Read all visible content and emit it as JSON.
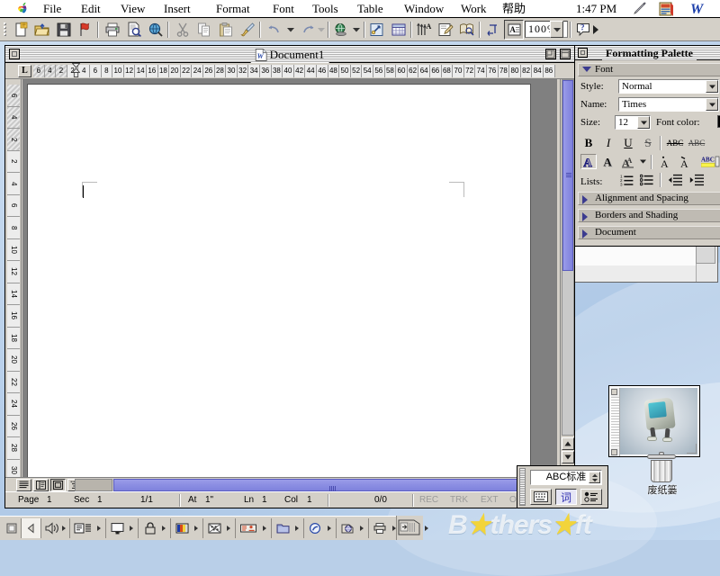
{
  "menubar": {
    "apple_icon": "apple-logo-icon",
    "items": [
      {
        "label": "File"
      },
      {
        "label": "Edit"
      },
      {
        "label": "View"
      },
      {
        "label": "Insert"
      },
      {
        "label": "Format"
      },
      {
        "label": "Font"
      },
      {
        "label": "Tools"
      },
      {
        "label": "Table"
      },
      {
        "label": "Window"
      },
      {
        "label": "Work"
      },
      {
        "label": "帮助"
      }
    ],
    "clock": "1:47 PM",
    "icons": [
      {
        "name": "pencil-icon"
      },
      {
        "name": "application-switcher-icon"
      },
      {
        "name": "word-app-icon",
        "label": "W"
      }
    ]
  },
  "toolbar": {
    "buttons": [
      {
        "name": "new-document-button",
        "tip": "New"
      },
      {
        "name": "open-file-button",
        "tip": "Open"
      },
      {
        "name": "save-button",
        "tip": "Save"
      },
      {
        "name": "flag-button",
        "tip": "Mail Recipient"
      },
      {
        "name": "print-button",
        "tip": "Print"
      },
      {
        "name": "print-preview-button",
        "tip": "Print Preview"
      },
      {
        "name": "spelling-button",
        "tip": "Spelling"
      },
      {
        "name": "cut-button",
        "tip": "Cut"
      },
      {
        "name": "copy-button",
        "tip": "Copy"
      },
      {
        "name": "paste-button",
        "tip": "Paste"
      },
      {
        "name": "format-painter-button",
        "tip": "Format Painter"
      },
      {
        "name": "undo-button",
        "tip": "Undo"
      },
      {
        "name": "redo-button",
        "tip": "Redo"
      },
      {
        "name": "web-toolbar-button",
        "tip": "Web"
      },
      {
        "name": "insert-hyperlink-button",
        "tip": "Insert Hyperlink"
      },
      {
        "name": "insert-table-button",
        "tip": "Insert Table"
      },
      {
        "name": "columns-button",
        "tip": "Columns"
      },
      {
        "name": "drawing-button",
        "tip": "Drawing"
      },
      {
        "name": "document-map-button",
        "tip": "Document Map"
      },
      {
        "name": "show-hide-paragraph-button",
        "tip": "Show/Hide ¶"
      },
      {
        "name": "format-palette-button",
        "tip": "Formatting Palette"
      },
      {
        "name": "help-button",
        "tip": "Help"
      }
    ],
    "zoom_value": "100%"
  },
  "document_window": {
    "title": "Document1",
    "icon": "word-document-icon",
    "close_box": "close-box",
    "zoom_box": "zoom-box",
    "collapse_box": "collapse-box",
    "ruler": {
      "tab_selector": "L",
      "h_labels": [
        "6",
        "4",
        "2",
        "2",
        "4",
        "6",
        "8",
        "10",
        "12",
        "14",
        "16",
        "18",
        "20",
        "22",
        "24",
        "26",
        "28",
        "30",
        "32",
        "34",
        "36",
        "38",
        "40",
        "42",
        "44",
        "46",
        "48",
        "50",
        "52",
        "54",
        "56",
        "58",
        "60",
        "62",
        "64",
        "66",
        "68",
        "70",
        "72",
        "74",
        "76",
        "78",
        "80",
        "82",
        "84",
        "86"
      ],
      "v_labels": [
        "6",
        "4",
        "2",
        "2",
        "4",
        "6",
        "8",
        "10",
        "12",
        "14",
        "16",
        "18",
        "20",
        "22",
        "24",
        "26",
        "28",
        "30"
      ]
    },
    "view_buttons": [
      {
        "name": "normal-view-button",
        "label": "Normal"
      },
      {
        "name": "online-view-button",
        "label": "Online Layout"
      },
      {
        "name": "page-layout-view-button",
        "label": "Page Layout",
        "active": true
      },
      {
        "name": "outline-view-button",
        "label": "Outline"
      }
    ],
    "scroll": {
      "up_arrow": "scroll-up-arrow",
      "down_arrow": "scroll-down-arrow",
      "prev_page": "previous-page-button",
      "select_browse": "select-browse-object-button",
      "next_page": "next-page-button"
    }
  },
  "statusbar": {
    "page_label": "Page",
    "page_value": "1",
    "sec_label": "Sec",
    "sec_value": "1",
    "pages": "1/1",
    "at_label": "At",
    "at_value": "1\"",
    "ln_label": "Ln",
    "ln_value": "1",
    "col_label": "Col",
    "col_value": "1",
    "words": "0/0",
    "rec": "REC",
    "trk": "TRK",
    "ext": "EXT",
    "ovr": "OVR"
  },
  "formatting_palette": {
    "title": "Formatting Palette",
    "sections": [
      {
        "name": "font-section",
        "label": "Font",
        "expanded": true
      },
      {
        "name": "alignment-spacing-section",
        "label": "Alignment and Spacing",
        "expanded": false
      },
      {
        "name": "borders-shading-section",
        "label": "Borders and Shading",
        "expanded": false
      },
      {
        "name": "document-section",
        "label": "Document",
        "expanded": false
      }
    ],
    "font": {
      "style_label": "Style:",
      "style_value": "Normal",
      "name_label": "Name:",
      "name_value": "Times",
      "size_label": "Size:",
      "size_value": "12",
      "font_color_label": "Font color:",
      "font_color_value": "#000000",
      "buttons": [
        {
          "name": "bold-button",
          "label": "B"
        },
        {
          "name": "italic-button",
          "label": "I"
        },
        {
          "name": "underline-button",
          "label": "U"
        },
        {
          "name": "strikethrough-button",
          "label": "S"
        },
        {
          "name": "all-caps-button",
          "label": "ABC"
        },
        {
          "name": "small-caps-button",
          "label": "ABC"
        },
        {
          "name": "outline-button",
          "label": "A"
        },
        {
          "name": "shadow-button",
          "label": "A"
        },
        {
          "name": "emboss-button",
          "label": "A"
        },
        {
          "name": "superscript-button",
          "label": "A"
        },
        {
          "name": "subscript-button",
          "label": "A"
        },
        {
          "name": "highlight-button",
          "label": "ABC"
        }
      ],
      "lists_label": "Lists:",
      "list_buttons": [
        {
          "name": "numbered-list-button"
        },
        {
          "name": "bulleted-list-button"
        },
        {
          "name": "decrease-indent-button"
        },
        {
          "name": "increase-indent-button"
        }
      ]
    }
  },
  "desktop": {
    "trash_label": "废纸篓",
    "picture_window": {
      "name": "desktop-picture-window",
      "image": "imac-computer-photo"
    },
    "watermark": {
      "prefix": "B",
      "star1": "★",
      "mid": "thers",
      "star2": "★",
      "suffix": "ft"
    }
  },
  "input_method": {
    "method_value": "ABC标准",
    "buttons": [
      {
        "name": "keyboard-button"
      },
      {
        "name": "word-input-button",
        "label": "词"
      },
      {
        "name": "options-button"
      }
    ]
  },
  "control_strip": {
    "modules": [
      {
        "name": "control-strip-toggle"
      },
      {
        "name": "sound-volume-module"
      },
      {
        "name": "keyboard-layout-module"
      },
      {
        "name": "monitor-resolution-module"
      },
      {
        "name": "file-sharing-module"
      },
      {
        "name": "color-depth-module"
      },
      {
        "name": "desktop-pattern-module"
      },
      {
        "name": "network-module"
      },
      {
        "name": "folder-module"
      },
      {
        "name": "sherlock-module"
      },
      {
        "name": "web-sharing-module"
      },
      {
        "name": "printer-module"
      },
      {
        "name": "cd-audio-module"
      },
      {
        "name": "microphone-module"
      }
    ],
    "handle": "control-strip-handle"
  }
}
